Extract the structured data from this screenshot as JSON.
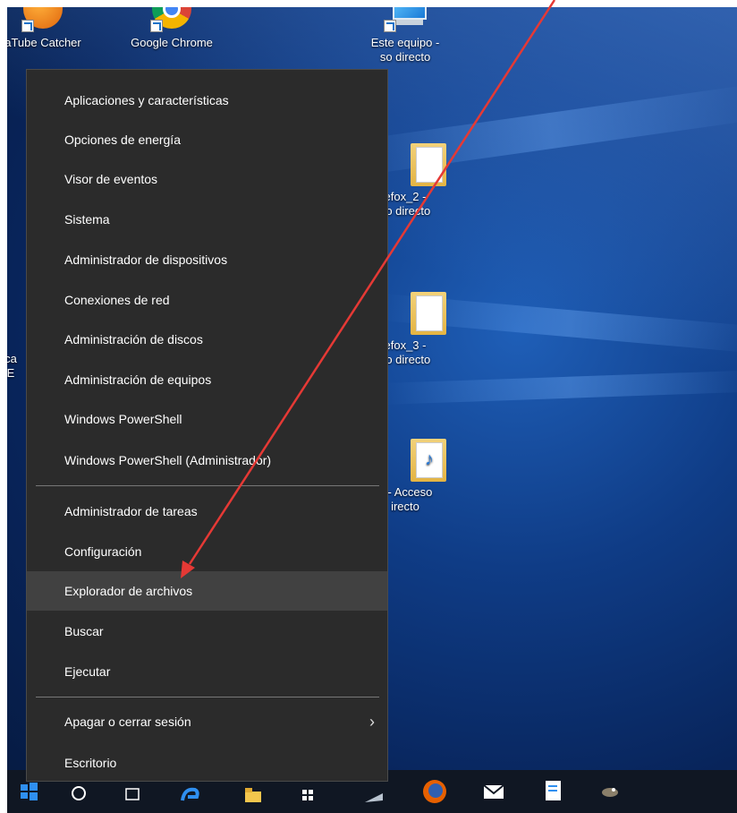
{
  "desktop": {
    "icons": [
      {
        "label": "aTube Catcher",
        "icon": "atube-catcher-icon"
      },
      {
        "label": "Google Chrome",
        "icon": "chrome-icon"
      },
      {
        "label": "Este equipo -",
        "label2": "so directo",
        "icon": "this-pc-icon"
      },
      {
        "label": "efox_2 -",
        "label2": "so directo",
        "icon": "folder-icon"
      },
      {
        "label": "efox_3 -",
        "label2": "so directo",
        "icon": "folder-icon"
      },
      {
        "label": "a - Acceso",
        "label2": "irecto",
        "icon": "folder-icon"
      },
      {
        "label": "ca",
        "label2": "E",
        "icon": "partial-icon"
      }
    ]
  },
  "menu": {
    "items": [
      {
        "label": "Aplicaciones y características"
      },
      {
        "label": "Opciones de energía"
      },
      {
        "label": "Visor de eventos"
      },
      {
        "label": "Sistema"
      },
      {
        "label": "Administrador de dispositivos"
      },
      {
        "label": "Conexiones de red"
      },
      {
        "label": "Administración de discos"
      },
      {
        "label": "Administración de equipos"
      },
      {
        "label": "Windows PowerShell"
      },
      {
        "label": "Windows PowerShell (Administrador)"
      },
      {
        "label": "Administrador de tareas"
      },
      {
        "label": "Configuración"
      },
      {
        "label": "Explorador de archivos",
        "highlighted": true
      },
      {
        "label": "Buscar"
      },
      {
        "label": "Ejecutar"
      },
      {
        "label": "Apagar o cerrar sesión",
        "chevron": "›"
      },
      {
        "label": "Escritorio"
      }
    ]
  },
  "taskbar": {
    "icons": [
      "start-icon",
      "cortana-icon",
      "task-view-icon",
      "edge-icon",
      "file-explorer-icon",
      "store-icon",
      "network-icon",
      "firefox-icon",
      "mail-icon",
      "document-icon",
      "gimp-icon"
    ]
  },
  "annotation": {
    "color": "#e53935"
  }
}
